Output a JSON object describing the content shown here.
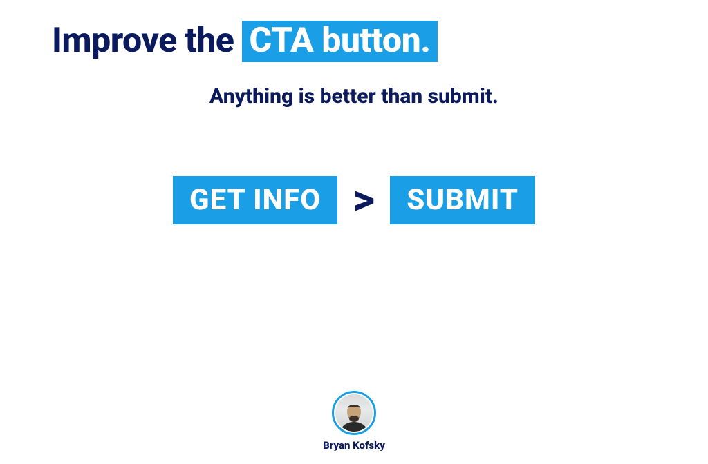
{
  "heading": {
    "prefix": "Improve the ",
    "highlight": "CTA button."
  },
  "subheading": "Anything is better than submit.",
  "comparison": {
    "better_label": "GET INFO",
    "symbol": ">",
    "worse_label": "SUBMIT"
  },
  "author": {
    "name": "Bryan Kofsky"
  },
  "colors": {
    "accent": "#1a9ee6",
    "text_dark": "#0a1a5c"
  }
}
